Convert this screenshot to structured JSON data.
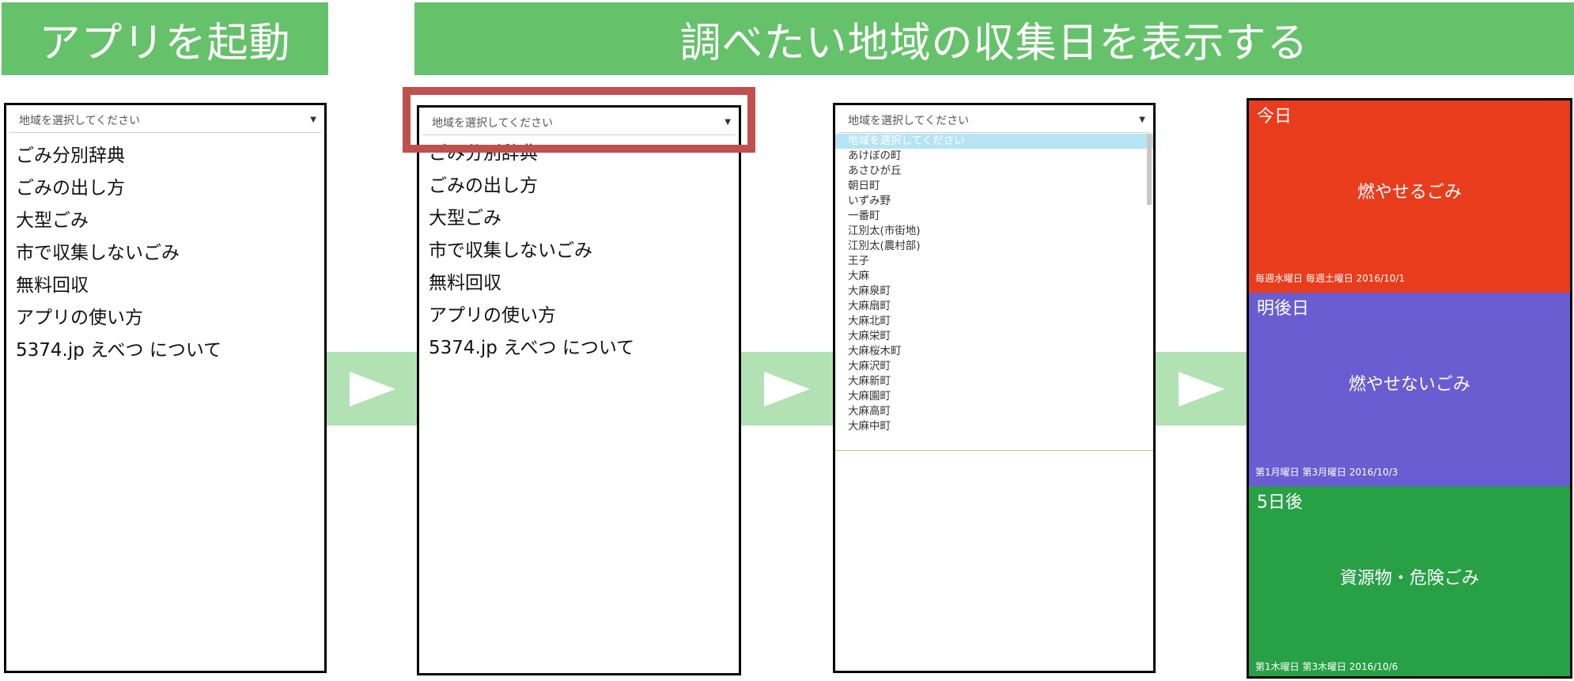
{
  "banners": {
    "launch": "アプリを起動",
    "show": "調べたい地域の収集日を表示する"
  },
  "select": {
    "placeholder": "地域を選択してください"
  },
  "menu": {
    "items": [
      "ごみ分別辞典",
      "ごみの出し方",
      "大型ごみ",
      "市で収集しないごみ",
      "無料回収",
      "アプリの使い方",
      "5374.jp えべつ について"
    ]
  },
  "dropdown": {
    "options": [
      "地域を選択してください",
      "あけぼの町",
      "あさひが丘",
      "朝日町",
      "いずみ野",
      "一番町",
      "江別太(市街地)",
      "江別太(農村部)",
      "王子",
      "大麻",
      "大麻泉町",
      "大麻扇町",
      "大麻北町",
      "大麻栄町",
      "大麻桜木町",
      "大麻沢町",
      "大麻新町",
      "大麻園町",
      "大麻高町",
      "大麻中町"
    ]
  },
  "cards": [
    {
      "day": "今日",
      "type": "燃やせるごみ",
      "schedule": "毎週水曜日 毎週土曜日 2016/10/1",
      "color": "#e93c1c"
    },
    {
      "day": "明後日",
      "type": "燃やせないごみ",
      "schedule": "第1月曜日 第3月曜日 2016/10/3",
      "color": "#6a5dd1"
    },
    {
      "day": "5日後",
      "type": "資源物・危険ごみ",
      "schedule": "第1木曜日 第3木曜日 2016/10/6",
      "color": "#28a046"
    }
  ],
  "colors": {
    "banner": "#66c16b",
    "arrow_bg": "#b2e1b3",
    "highlight": "#c0504d"
  },
  "icons": {
    "arrow": "play-arrow-icon",
    "caret": "caret-down-icon"
  }
}
